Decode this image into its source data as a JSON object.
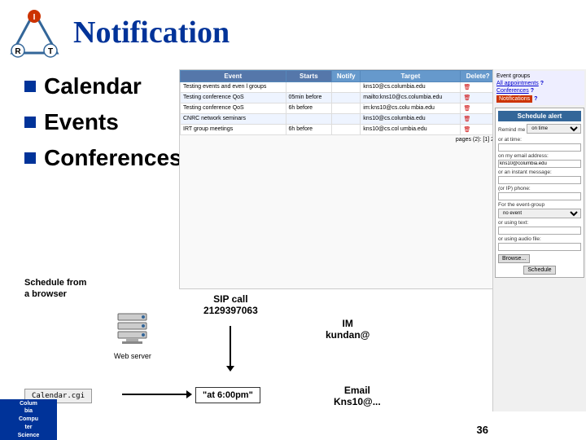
{
  "logo": {
    "triangle_labels": [
      "I",
      "R",
      "T"
    ]
  },
  "title": "Notification",
  "bullets": [
    {
      "label": "Calendar"
    },
    {
      "label": "Events"
    },
    {
      "label": "Conferences"
    }
  ],
  "table": {
    "headers": [
      "Event",
      "Starts",
      "Notify",
      "Target",
      "Delete?"
    ],
    "rows": [
      {
        "event": "Testing events and even l groups",
        "starts": "",
        "notify": "",
        "target": "kns10@cs.columbia.edu",
        "delete": true
      },
      {
        "event": "Testing conference QoS",
        "starts": "05min before",
        "notify": "",
        "target": "mailto:kns10@cs.columbia.edu",
        "delete": true
      },
      {
        "event": "Testing conference QoS",
        "starts": "6h before",
        "notify": "",
        "target": "im:kns10@cs.colu mbia.edu",
        "delete": true
      },
      {
        "event": "CNRC network seminars",
        "starts": "",
        "notify": "",
        "target": "kns10@cs.columbia.edu",
        "delete": true
      },
      {
        "event": "IRT group meetings",
        "starts": "6h before",
        "notify": "",
        "target": "kns10@cs.col umbia.edu",
        "delete": true
      }
    ]
  },
  "right_panel": {
    "event_groups_label": "Event groups",
    "all_appointments_label": "All appointments",
    "conferences_label": "Conferences",
    "notifications_label": "Notifications",
    "schedule_alert_title": "Schedule alert",
    "remind_me_label": "Remind me",
    "on_time_label": "on time",
    "or_at_time_label": "or at time:",
    "on_my_email_label": "on my email address:",
    "email_value": "kns10@columbia.edu",
    "or_instant_label": "or an instant message:",
    "for_ip_phone_label": "(or IP) phone:",
    "for_event_group_label": "For the event-group",
    "no_event_label": "no event",
    "or_using_text_label": "or using text:",
    "or_using_audio_label": "or using audio file:",
    "browse_label": "Browse...",
    "schedule_label": "Schedule"
  },
  "diagram": {
    "browser_label": "Schedule from\na browser",
    "web_server_label": "Web server",
    "sip_call_label": "SIP call\n2129397063",
    "im_label": "IM\nkundan@",
    "calendar_cgi_label": "Calendar.cgi",
    "at_time_label": "\"at 6:00pm\"",
    "email_label": "Email\nKns10@..."
  },
  "pages_text": "pages (2): [1] 2",
  "page_number": "36",
  "columbia": {
    "line1": "Colum",
    "line2": "bia",
    "line3": "Compu",
    "line4": "ter",
    "line5": "Science"
  }
}
